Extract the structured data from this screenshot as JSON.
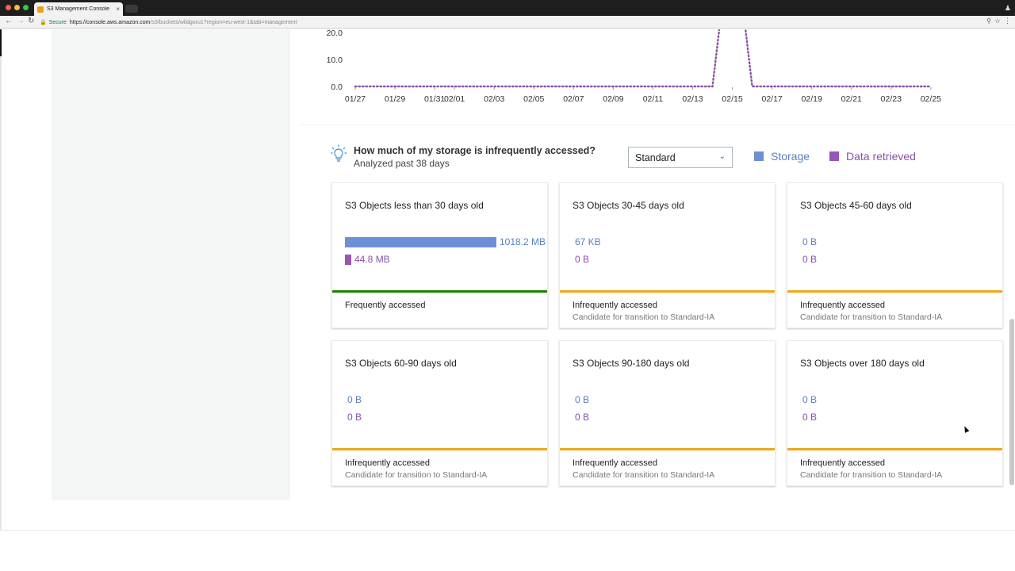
{
  "browser": {
    "tab_title": "S3 Management Console",
    "tab_close": "×",
    "url_secure": "Secure",
    "url_host": "https://console.aws.amazon.com",
    "url_path": "/s3/buckets/wildguru1?region=eu-west-1&tab=management",
    "icons": [
      "back-icon",
      "forward-icon",
      "reload-icon",
      "lock-icon",
      "zoom-icon",
      "star-icon",
      "menu-icon"
    ]
  },
  "chart_data": {
    "type": "line",
    "title": "",
    "xlabel": "",
    "ylabel": "",
    "yticks": [
      "20.0",
      "10.0",
      "0.0"
    ],
    "ylim_visible": [
      0,
      20
    ],
    "x_ticks": [
      "01/27",
      "01/29",
      "01/31",
      "02/01",
      "02/03",
      "02/05",
      "02/07",
      "02/09",
      "02/11",
      "02/13",
      "02/15",
      "02/17",
      "02/19",
      "02/21",
      "02/23",
      "02/25"
    ],
    "series": [
      {
        "color": "#8a52a6",
        "style": "dotted",
        "points": [
          [
            "01/27",
            0
          ],
          [
            "02/13",
            0
          ],
          [
            "02/14",
            0
          ],
          [
            "02/14.4",
            25
          ],
          [
            "02/15.6",
            25
          ],
          [
            "02/16",
            0
          ],
          [
            "02/25",
            0
          ]
        ]
      }
    ],
    "grid": false,
    "legend": "none"
  },
  "question": {
    "title": "How much of my storage is infrequently accessed?",
    "subtitle": "Analyzed past 38 days"
  },
  "storage_class_select": {
    "value": "Standard"
  },
  "legend": {
    "storage": {
      "label": "Storage",
      "color": "#6d8fd6"
    },
    "retrieved": {
      "label": "Data retrieved",
      "color": "#9656b4"
    }
  },
  "cards": [
    {
      "title": "S3 Objects less than 30 days old",
      "storage": "1018.2 MB",
      "storage_fraction": 1.0,
      "retrieved": "44.8 MB",
      "retrieved_fraction": 0.044,
      "status": "Frequently accessed",
      "substatus": "",
      "status_color": "#1d8102"
    },
    {
      "title": "S3 Objects 30-45 days old",
      "storage": "67 KB",
      "storage_fraction": 0,
      "retrieved": "0 B",
      "retrieved_fraction": 0,
      "status": "Infrequently accessed",
      "substatus": "Candidate for transition to Standard-IA",
      "status_color": "#f0a71c"
    },
    {
      "title": "S3 Objects 45-60 days old",
      "storage": "0 B",
      "storage_fraction": 0,
      "retrieved": "0 B",
      "retrieved_fraction": 0,
      "status": "Infrequently accessed",
      "substatus": "Candidate for transition to Standard-IA",
      "status_color": "#f0a71c"
    },
    {
      "title": "S3 Objects 60-90 days old",
      "storage": "0 B",
      "storage_fraction": 0,
      "retrieved": "0 B",
      "retrieved_fraction": 0,
      "status": "Infrequently accessed",
      "substatus": "Candidate for transition to Standard-IA",
      "status_color": "#f0a71c"
    },
    {
      "title": "S3 Objects 90-180 days old",
      "storage": "0 B",
      "storage_fraction": 0,
      "retrieved": "0 B",
      "retrieved_fraction": 0,
      "status": "Infrequently accessed",
      "substatus": "Candidate for transition to Standard-IA",
      "status_color": "#f0a71c"
    },
    {
      "title": "S3 Objects over 180 days old",
      "storage": "0 B",
      "storage_fraction": 0,
      "retrieved": "0 B",
      "retrieved_fraction": 0,
      "status": "Infrequently accessed",
      "substatus": "Candidate for transition to Standard-IA",
      "status_color": "#f0a71c"
    }
  ]
}
